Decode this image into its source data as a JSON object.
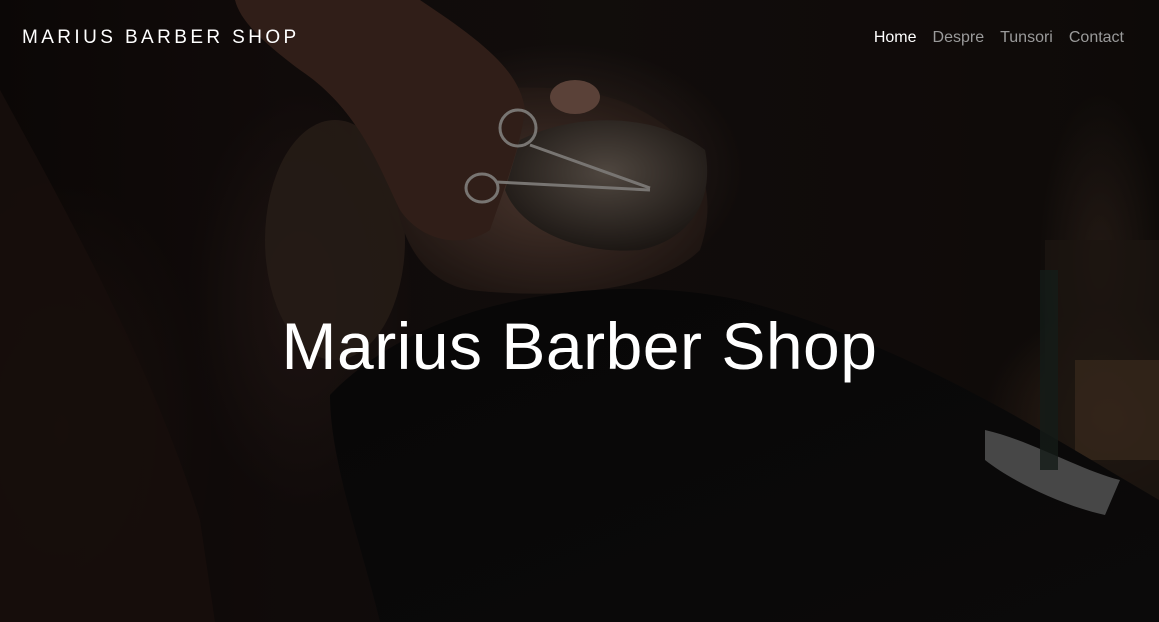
{
  "navbar": {
    "brand": "MARIUS BARBER SHOP",
    "links": [
      {
        "label": "Home",
        "active": true
      },
      {
        "label": "Despre",
        "active": false
      },
      {
        "label": "Tunsori",
        "active": false
      },
      {
        "label": "Contact",
        "active": false
      }
    ]
  },
  "hero": {
    "title": "Marius Barber Shop",
    "background_subject": "barber trimming a customer's beard with scissors"
  },
  "colors": {
    "nav_active": "#ffffff",
    "nav_inactive": "#9a9a9a",
    "overlay": "#000000"
  }
}
